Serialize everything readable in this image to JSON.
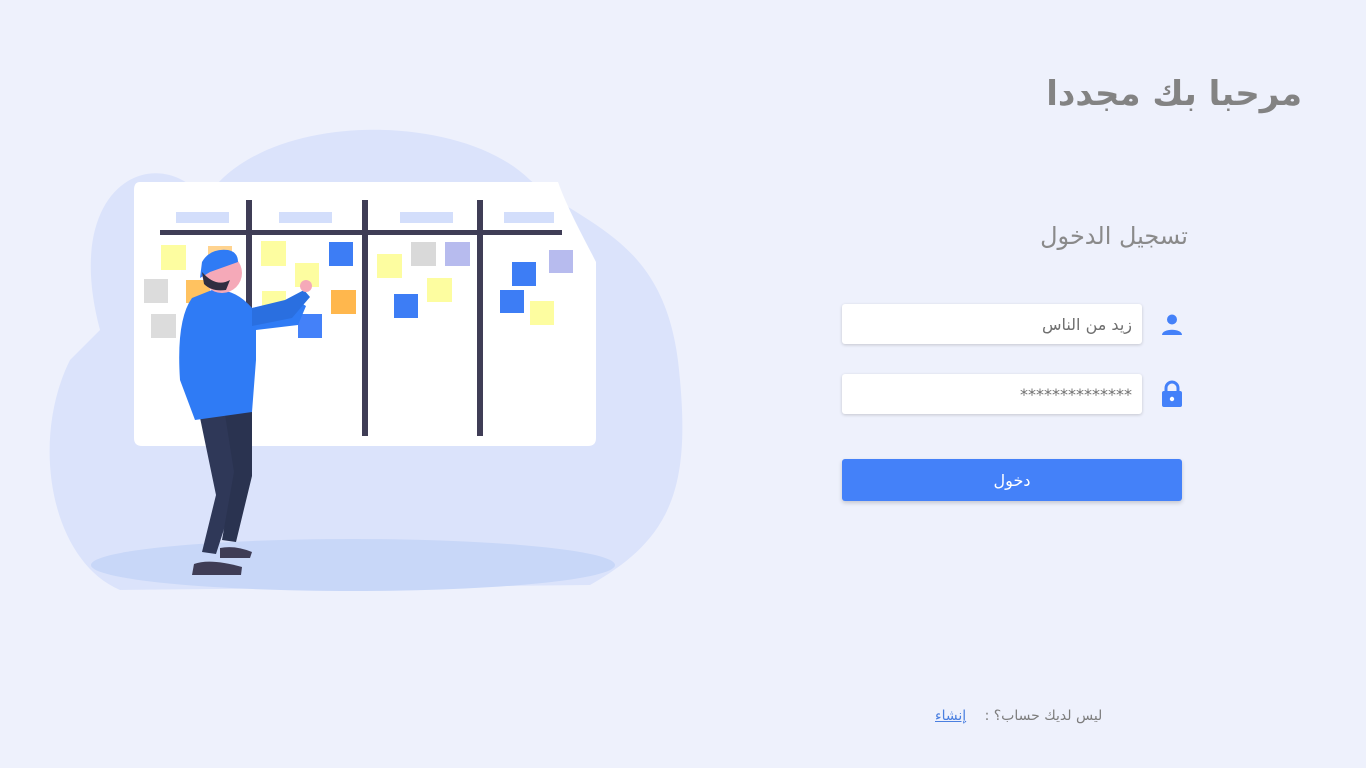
{
  "header": {
    "welcome_title": "مرحبا بك مجددا"
  },
  "login_form": {
    "heading": "تسجيل الدخول",
    "username": {
      "value": "زيد من الناس",
      "icon": "user-icon"
    },
    "password": {
      "value": "**************",
      "icon": "lock-icon"
    },
    "submit_label": "دخول"
  },
  "signup": {
    "prompt": "ليس لديك حساب؟ :",
    "link_label": "إنشاء"
  },
  "colors": {
    "background": "#eef1fc",
    "accent": "#4481f9",
    "title": "#838383",
    "link": "#4a7fe0"
  }
}
